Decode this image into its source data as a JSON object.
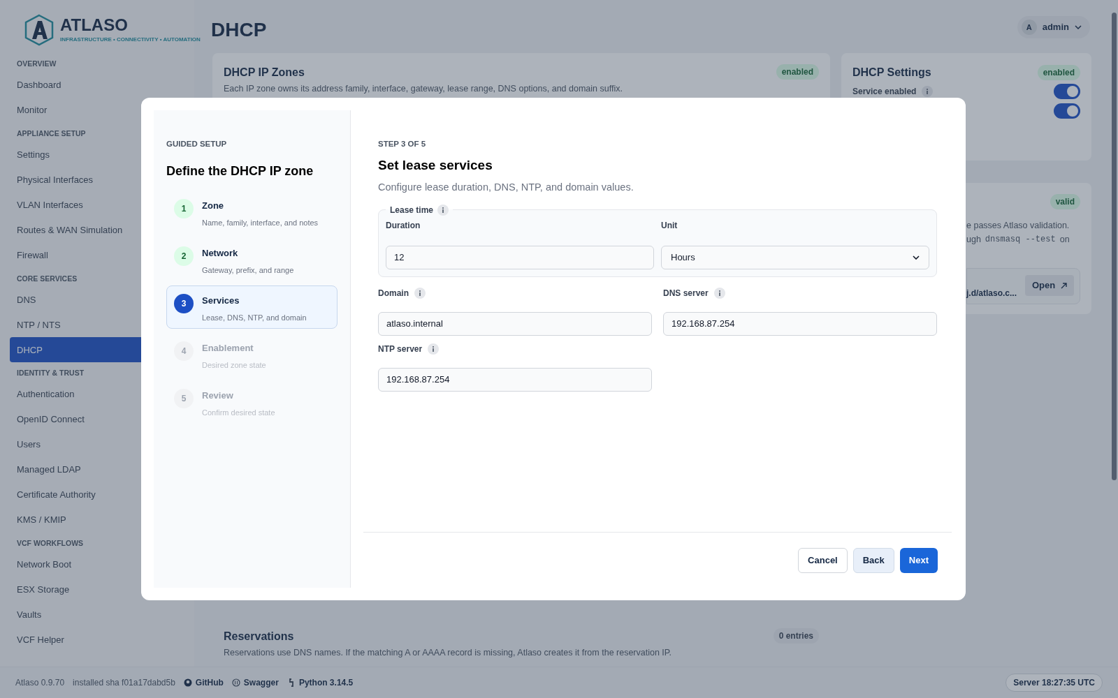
{
  "brand": {
    "name": "ATLASO",
    "tagline": "INFRASTRUCTURE • CONNECTIVITY • AUTOMATION"
  },
  "sidebar": {
    "sections": [
      {
        "title": "OVERVIEW",
        "items": [
          {
            "label": "Dashboard",
            "selected": false
          },
          {
            "label": "Monitor",
            "selected": false
          }
        ]
      },
      {
        "title": "APPLIANCE SETUP",
        "items": [
          {
            "label": "Settings",
            "selected": false
          },
          {
            "label": "Physical Interfaces",
            "selected": false
          },
          {
            "label": "VLAN Interfaces",
            "selected": false
          },
          {
            "label": "Routes & WAN Simulation",
            "selected": false
          },
          {
            "label": "Firewall",
            "selected": false
          }
        ]
      },
      {
        "title": "CORE SERVICES",
        "items": [
          {
            "label": "DNS",
            "selected": false
          },
          {
            "label": "NTP / NTS",
            "selected": false
          },
          {
            "label": "DHCP",
            "selected": true
          }
        ]
      },
      {
        "title": "IDENTITY & TRUST",
        "items": [
          {
            "label": "Authentication",
            "selected": false
          },
          {
            "label": "OpenID Connect",
            "selected": false
          },
          {
            "label": "Users",
            "selected": false
          },
          {
            "label": "Managed LDAP",
            "selected": false
          },
          {
            "label": "Certificate Authority",
            "selected": false
          },
          {
            "label": "KMS / KMIP",
            "selected": false
          }
        ]
      },
      {
        "title": "VCF WORKFLOWS",
        "items": [
          {
            "label": "Network Boot",
            "selected": false
          },
          {
            "label": "ESX Storage",
            "selected": false
          },
          {
            "label": "Vaults",
            "selected": false
          },
          {
            "label": "VCF Helper",
            "selected": false
          }
        ]
      }
    ]
  },
  "page_title": "DHCP",
  "user": {
    "initial": "A",
    "name": "admin"
  },
  "zones_card": {
    "title": "DHCP IP Zones",
    "description": "Each IP zone owns its address family, interface, gateway, lease range, DNS options, and domain suffix.",
    "badge": "enabled"
  },
  "settings_card": {
    "title": "DHCP Settings",
    "badge": "enabled",
    "toggles": [
      {
        "label": "Service enabled",
        "on": true
      },
      {
        "on": true
      }
    ]
  },
  "validation_card": {
    "badge": "valid",
    "lines": [
      "e passes Atlaso validation.",
      "ugh"
    ],
    "command": "dnsmasq --test",
    "after": "on",
    "path": "j.d/atlaso.c...",
    "button": "Open"
  },
  "reservations_card": {
    "title": "Reservations",
    "description": "Reservations use DNS names. If the matching A or AAAA record is missing, Atlaso creates it from the reservation IP.",
    "badge": "0 entries"
  },
  "footer": {
    "version": "Atlaso 0.9.70",
    "sha": "installed sha f01a17dabd5b",
    "links": [
      "GitHub",
      "Swagger",
      "Python 3.14.5"
    ],
    "server": "Server 18:27:35 UTC"
  },
  "modal": {
    "eyebrow": "GUIDED SETUP",
    "title": "Define the DHCP IP zone",
    "steps": [
      {
        "number": "1",
        "title": "Zone",
        "subtitle": "Name, family, interface, and notes",
        "done": true,
        "selected": false
      },
      {
        "number": "2",
        "title": "Network",
        "subtitle": "Gateway, prefix, and range",
        "done": true,
        "selected": false
      },
      {
        "number": "3",
        "title": "Services",
        "subtitle": "Lease, DNS, NTP, and domain",
        "done": false,
        "selected": true
      },
      {
        "number": "4",
        "title": "Enablement",
        "subtitle": "Desired zone state",
        "done": false,
        "selected": false
      },
      {
        "number": "5",
        "title": "Review",
        "subtitle": "Confirm desired state",
        "done": false,
        "selected": false
      }
    ],
    "step_label": "STEP 3 OF 5",
    "heading": "Set lease services",
    "subheading": "Configure lease duration, DNS, NTP, and domain values.",
    "lease": {
      "legend": "Lease time",
      "duration_label": "Duration",
      "duration": "12",
      "unit_label": "Unit",
      "unit": "Hours"
    },
    "fields": [
      {
        "label": "Domain",
        "value": "atlaso.internal"
      },
      {
        "label": "DNS server",
        "value": "192.168.87.254"
      },
      {
        "label": "NTP server",
        "value": "192.168.87.254"
      }
    ],
    "buttons": [
      {
        "label": "Cancel",
        "kind": "secondary"
      },
      {
        "label": "Back",
        "kind": "soft"
      },
      {
        "label": "Next",
        "kind": "primary"
      }
    ]
  }
}
